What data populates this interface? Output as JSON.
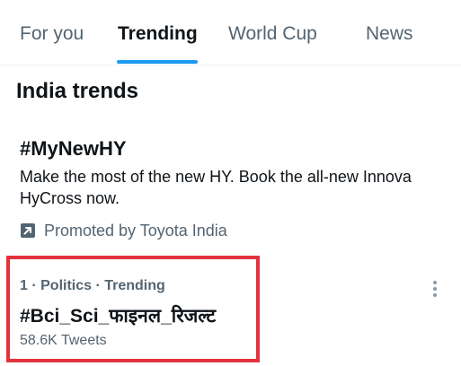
{
  "tabs": [
    {
      "label": "For you",
      "active": false
    },
    {
      "label": "Trending",
      "active": true
    },
    {
      "label": "World Cup",
      "active": false
    },
    {
      "label": "News",
      "active": false
    }
  ],
  "section_title": "India trends",
  "promoted": {
    "hashtag": "#MyNewHY",
    "description": "Make the most of the new HY. Book the all-new Innova HyCross now.",
    "promoted_by": "Promoted by Toyota India",
    "icon": "promoted-arrow-icon"
  },
  "trend": {
    "meta": "1 · Politics · Trending",
    "name": "#Bci_Sci_फाइनल_रिजल्ट",
    "tweet_count": "58.6K Tweets",
    "more_icon": "more-options-icon"
  },
  "colors": {
    "accent": "#1d9bf0",
    "highlight": "#e3323b",
    "text_primary": "#0f1419",
    "text_secondary": "#536471"
  }
}
